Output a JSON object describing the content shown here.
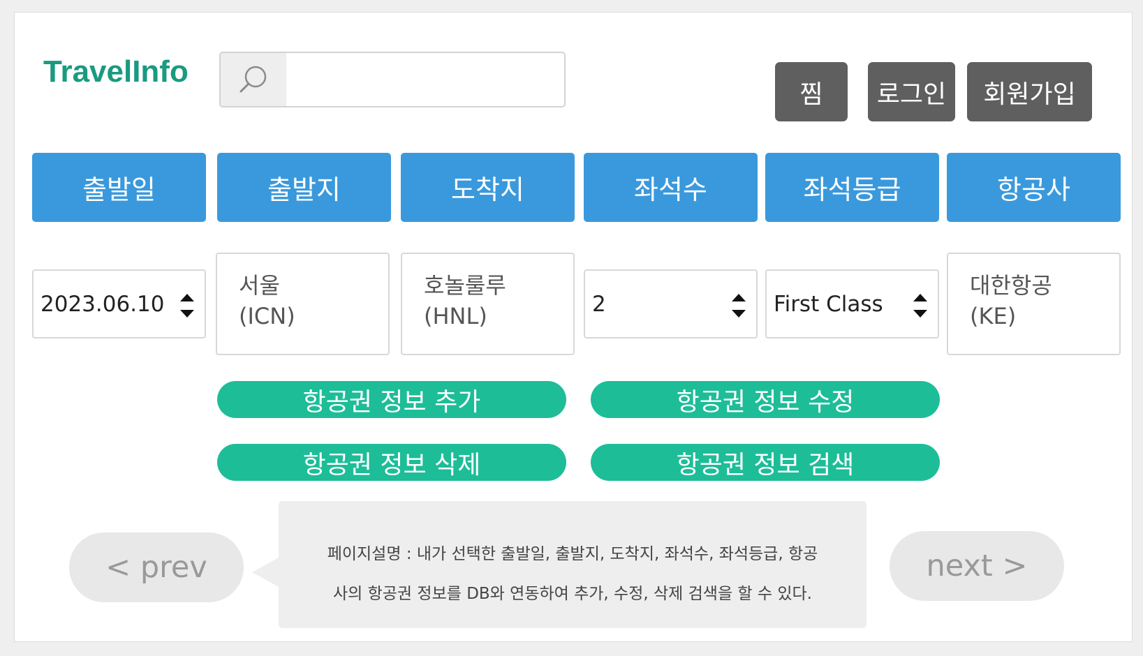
{
  "header": {
    "logo": "TravelInfo",
    "search": {
      "value": "",
      "placeholder": ""
    },
    "buttons": {
      "wishlist": "찜",
      "login": "로그인",
      "signup": "회원가입"
    }
  },
  "categories": [
    "출발일",
    "출발지",
    "도착지",
    "좌석수",
    "좌석등급",
    "항공사"
  ],
  "fields": {
    "departure_date": "2023.06.10",
    "origin": {
      "line1": "서울",
      "line2": "(ICN)"
    },
    "destination": {
      "line1": "호놀룰루",
      "line2": "(HNL)"
    },
    "seats": "2",
    "seat_class": "First Class",
    "airline": {
      "line1": "대한항공",
      "line2": "(KE)"
    }
  },
  "actions": {
    "add": "항공권 정보 추가",
    "edit": "항공권 정보 수정",
    "delete": "항공권 정보 삭제",
    "search": "항공권 정보 검색"
  },
  "nav": {
    "prev": "< prev",
    "next": "next >"
  },
  "description": {
    "line1": "페이지설명 : 내가 선택한 출발일, 출발지, 도착지, 좌석수, 좌석등급, 항공",
    "line2": "사의 항공권 정보를 DB와 연동하여 추가, 수정, 삭제 검색을 할 수 있다."
  },
  "colors": {
    "logo": "#1a9a80",
    "category": "#3a99dc",
    "action": "#1dbd98",
    "topbutton": "#5f5f5f"
  }
}
